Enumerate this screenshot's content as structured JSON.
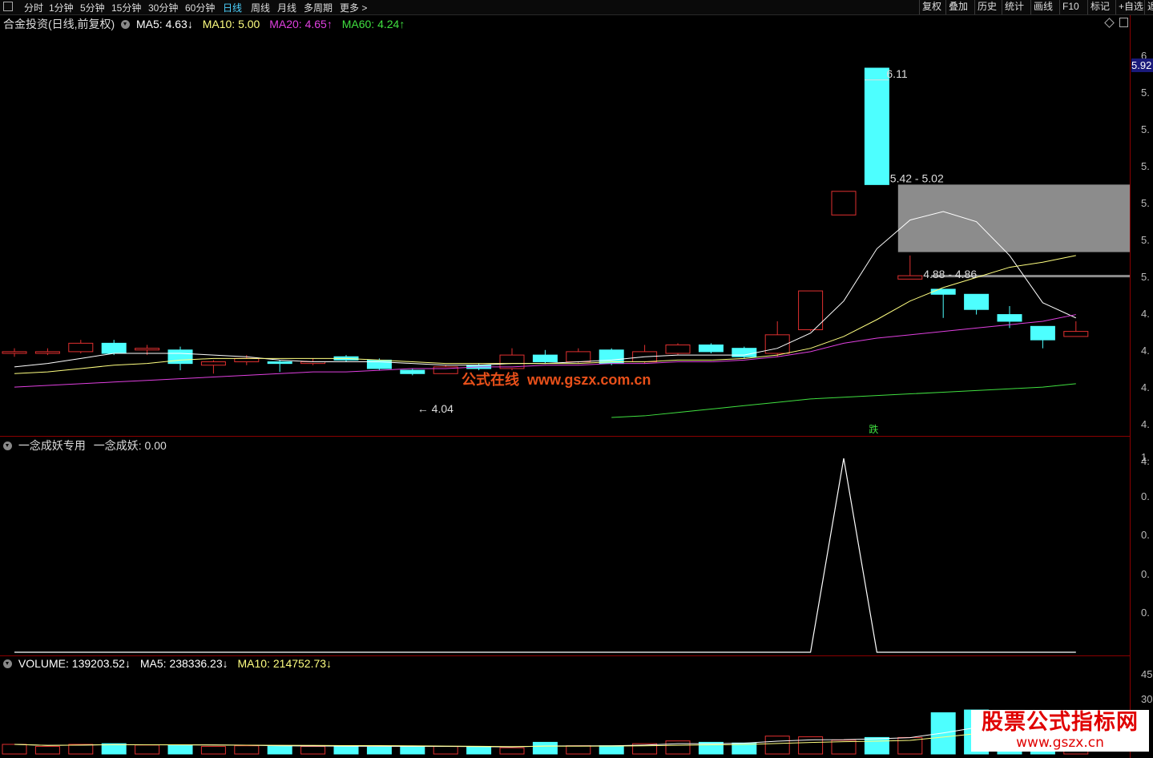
{
  "toolbar": {
    "tabs": [
      "分时",
      "1分钟",
      "5分钟",
      "15分钟",
      "30分钟",
      "60分钟",
      "日线",
      "周线",
      "月线",
      "多周期",
      "更多 >"
    ],
    "active": "日线",
    "right_buttons": [
      "复权",
      "叠加",
      "历史",
      "统计",
      "画线",
      "F10",
      "标记",
      "+自选",
      "返"
    ]
  },
  "main_panel": {
    "title": "合金投资(日线,前复权)",
    "ma": [
      {
        "label": "MA5: 4.63↓",
        "color": "#ffffff"
      },
      {
        "label": "MA10: 5.00",
        "color": "#ffff80"
      },
      {
        "label": "MA20: 4.65↑",
        "color": "#e040e0"
      },
      {
        "label": "MA60: 4.24↑",
        "color": "#40e040"
      }
    ],
    "annotations": {
      "high": "6.11",
      "box1": "5.42 - 5.02",
      "box2": "4.88 - 4.86",
      "low": "4.04",
      "tag": "跌"
    },
    "current_price": "5.92",
    "watermark": "公式在线  www.gszx.com.cn"
  },
  "indicator_panel": {
    "title": "一念成妖专用",
    "value_label": "一念成妖: 0.00"
  },
  "volume_panel": {
    "label": "VOLUME: 139203.52↓",
    "ma5": "MA5: 238336.23↓",
    "ma10": "MA10: 214752.73↓"
  },
  "y_axis": {
    "main": [
      "6",
      "5.",
      "5.",
      "5.",
      "5.",
      "5.",
      "5.",
      "4.",
      "4.",
      "4.",
      "4.",
      "4."
    ],
    "indicator": [
      "1.",
      "0.",
      "0.",
      "0.",
      "0."
    ],
    "volume": [
      "450",
      "300"
    ]
  },
  "logo": {
    "line1": "股票公式指标网",
    "line2": "www.gszx.cn"
  },
  "colors": {
    "up": "#e03030",
    "down": "#4dffff",
    "ma5": "#ffffff",
    "ma10": "#ffff80",
    "ma20": "#e040e0",
    "ma60": "#40e040"
  },
  "chart_data": {
    "type": "candlestick",
    "price_range": [
      3.95,
      6.3
    ],
    "candles": [
      {
        "o": 4.42,
        "c": 4.43,
        "h": 4.45,
        "l": 4.4
      },
      {
        "o": 4.42,
        "c": 4.43,
        "h": 4.45,
        "l": 4.41
      },
      {
        "o": 4.43,
        "c": 4.48,
        "h": 4.5,
        "l": 4.42
      },
      {
        "o": 4.48,
        "c": 4.42,
        "h": 4.5,
        "l": 4.41
      },
      {
        "o": 4.44,
        "c": 4.45,
        "h": 4.47,
        "l": 4.41
      },
      {
        "o": 4.44,
        "c": 4.36,
        "h": 4.46,
        "l": 4.32
      },
      {
        "o": 4.35,
        "c": 4.37,
        "h": 4.38,
        "l": 4.3
      },
      {
        "o": 4.37,
        "c": 4.39,
        "h": 4.41,
        "l": 4.35
      },
      {
        "o": 4.37,
        "c": 4.36,
        "h": 4.38,
        "l": 4.31
      },
      {
        "o": 4.36,
        "c": 4.37,
        "h": 4.39,
        "l": 4.35
      },
      {
        "o": 4.4,
        "c": 4.38,
        "h": 4.41,
        "l": 4.37
      },
      {
        "o": 4.38,
        "c": 4.33,
        "h": 4.39,
        "l": 4.32
      },
      {
        "o": 4.32,
        "c": 4.3,
        "h": 4.33,
        "l": 4.29
      },
      {
        "o": 4.3,
        "c": 4.34,
        "h": 4.35,
        "l": 4.3
      },
      {
        "o": 4.35,
        "c": 4.33,
        "h": 4.36,
        "l": 4.32
      },
      {
        "o": 4.33,
        "c": 4.41,
        "h": 4.45,
        "l": 4.32
      },
      {
        "o": 4.41,
        "c": 4.37,
        "h": 4.44,
        "l": 4.36
      },
      {
        "o": 4.37,
        "c": 4.43,
        "h": 4.45,
        "l": 4.36
      },
      {
        "o": 4.44,
        "c": 4.36,
        "h": 4.45,
        "l": 4.35
      },
      {
        "o": 4.37,
        "c": 4.43,
        "h": 4.47,
        "l": 4.36
      },
      {
        "o": 4.42,
        "c": 4.47,
        "h": 4.48,
        "l": 4.41
      },
      {
        "o": 4.47,
        "c": 4.43,
        "h": 4.48,
        "l": 4.42
      },
      {
        "o": 4.45,
        "c": 4.4,
        "h": 4.46,
        "l": 4.39
      },
      {
        "o": 4.42,
        "c": 4.53,
        "h": 4.61,
        "l": 4.4
      },
      {
        "o": 4.56,
        "c": 4.79,
        "h": 4.79,
        "l": 4.55
      },
      {
        "o": 5.24,
        "c": 5.38,
        "h": 5.38,
        "l": 5.24
      },
      {
        "o": 6.11,
        "c": 5.42,
        "h": 6.11,
        "l": 5.42
      },
      {
        "o": 4.86,
        "c": 4.88,
        "h": 5.0,
        "l": 4.86
      },
      {
        "o": 4.8,
        "c": 4.77,
        "h": 4.8,
        "l": 4.63
      },
      {
        "o": 4.77,
        "c": 4.68,
        "h": 4.77,
        "l": 4.65
      },
      {
        "o": 4.65,
        "c": 4.61,
        "h": 4.7,
        "l": 4.57
      },
      {
        "o": 4.58,
        "c": 4.5,
        "h": 4.58,
        "l": 4.45
      },
      {
        "o": 4.52,
        "c": 4.55,
        "h": 4.61,
        "l": 4.52
      }
    ],
    "ma5": [
      4.34,
      4.36,
      4.39,
      4.42,
      4.42,
      4.42,
      4.41,
      4.4,
      4.38,
      4.37,
      4.37,
      4.37,
      4.36,
      4.35,
      4.35,
      4.36,
      4.36,
      4.37,
      4.38,
      4.4,
      4.41,
      4.41,
      4.41,
      4.45,
      4.54,
      4.73,
      5.04,
      5.21,
      5.26,
      5.2,
      5.0,
      4.72,
      4.63
    ],
    "ma10": [
      4.3,
      4.31,
      4.33,
      4.35,
      4.36,
      4.38,
      4.39,
      4.39,
      4.39,
      4.39,
      4.39,
      4.38,
      4.37,
      4.36,
      4.36,
      4.36,
      4.36,
      4.36,
      4.37,
      4.37,
      4.38,
      4.38,
      4.39,
      4.41,
      4.45,
      4.52,
      4.62,
      4.73,
      4.81,
      4.87,
      4.93,
      4.96,
      5.0
    ],
    "ma20": [
      4.22,
      4.23,
      4.24,
      4.25,
      4.26,
      4.27,
      4.28,
      4.29,
      4.3,
      4.31,
      4.31,
      4.32,
      4.33,
      4.33,
      4.34,
      4.34,
      4.35,
      4.35,
      4.36,
      4.36,
      4.37,
      4.37,
      4.38,
      4.4,
      4.43,
      4.48,
      4.51,
      4.53,
      4.55,
      4.57,
      4.59,
      4.61,
      4.65
    ],
    "ma60": [
      4.04,
      4.05,
      4.07,
      4.09,
      4.11,
      4.13,
      4.15,
      4.16,
      4.17,
      4.18,
      4.19,
      4.2,
      4.21,
      4.22,
      4.24
    ],
    "indicator": [
      0,
      0,
      0,
      0,
      0,
      0,
      0,
      0,
      0,
      0,
      0,
      0,
      0,
      0,
      0,
      0,
      0,
      0,
      0,
      0,
      0,
      0,
      0,
      0,
      0,
      1,
      0,
      0,
      0,
      0,
      0,
      0,
      0
    ],
    "volume_range": [
      0,
      600
    ],
    "volume": [
      70,
      55,
      70,
      75,
      65,
      65,
      55,
      60,
      55,
      55,
      60,
      50,
      55,
      55,
      50,
      45,
      85,
      60,
      60,
      75,
      95,
      85,
      80,
      130,
      125,
      100,
      120,
      120,
      300,
      320,
      95,
      85,
      55
    ]
  }
}
